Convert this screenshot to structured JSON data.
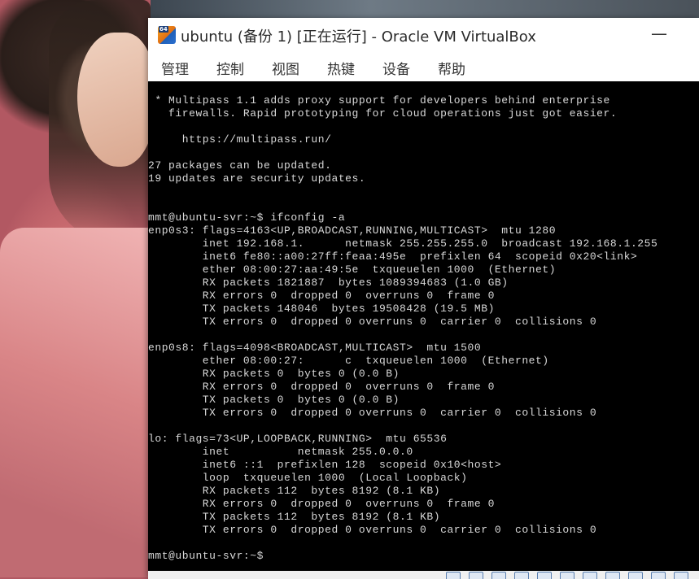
{
  "window": {
    "title": "ubuntu (备份 1) [正在运行] - Oracle VM VirtualBox",
    "icon_label": "64",
    "minimize_label": "—"
  },
  "menu": [
    {
      "label": "管理"
    },
    {
      "label": "控制"
    },
    {
      "label": "视图"
    },
    {
      "label": "热键"
    },
    {
      "label": "设备"
    },
    {
      "label": "帮助"
    }
  ],
  "terminal": {
    "lines": [
      " * Multipass 1.1 adds proxy support for developers behind enterprise",
      "   firewalls. Rapid prototyping for cloud operations just got easier.",
      "",
      "     https://multipass.run/",
      "",
      "27 packages can be updated.",
      "19 updates are security updates.",
      "",
      "",
      "mmt@ubuntu-svr:~$ ifconfig -a",
      "enp0s3: flags=4163<UP,BROADCAST,RUNNING,MULTICAST>  mtu 1280",
      "        inet 192.168.1.      netmask 255.255.255.0  broadcast 192.168.1.255",
      "        inet6 fe80::a00:27ff:feaa:495e  prefixlen 64  scopeid 0x20<link>",
      "        ether 08:00:27:aa:49:5e  txqueuelen 1000  (Ethernet)",
      "        RX packets 1821887  bytes 1089394683 (1.0 GB)",
      "        RX errors 0  dropped 0  overruns 0  frame 0",
      "        TX packets 148046  bytes 19508428 (19.5 MB)",
      "        TX errors 0  dropped 0 overruns 0  carrier 0  collisions 0",
      "",
      "enp0s8: flags=4098<BROADCAST,MULTICAST>  mtu 1500",
      "        ether 08:00:27:      c  txqueuelen 1000  (Ethernet)",
      "        RX packets 0  bytes 0 (0.0 B)",
      "        RX errors 0  dropped 0  overruns 0  frame 0",
      "        TX packets 0  bytes 0 (0.0 B)",
      "        TX errors 0  dropped 0 overruns 0  carrier 0  collisions 0",
      "",
      "lo: flags=73<UP,LOOPBACK,RUNNING>  mtu 65536",
      "        inet          netmask 255.0.0.0",
      "        inet6 ::1  prefixlen 128  scopeid 0x10<host>",
      "        loop  txqueuelen 1000  (Local Loopback)",
      "        RX packets 112  bytes 8192 (8.1 KB)",
      "        RX errors 0  dropped 0  overruns 0  frame 0",
      "        TX packets 112  bytes 8192 (8.1 KB)",
      "        TX errors 0  dropped 0 overruns 0  carrier 0  collisions 0",
      "",
      "mmt@ubuntu-svr:~$"
    ]
  }
}
